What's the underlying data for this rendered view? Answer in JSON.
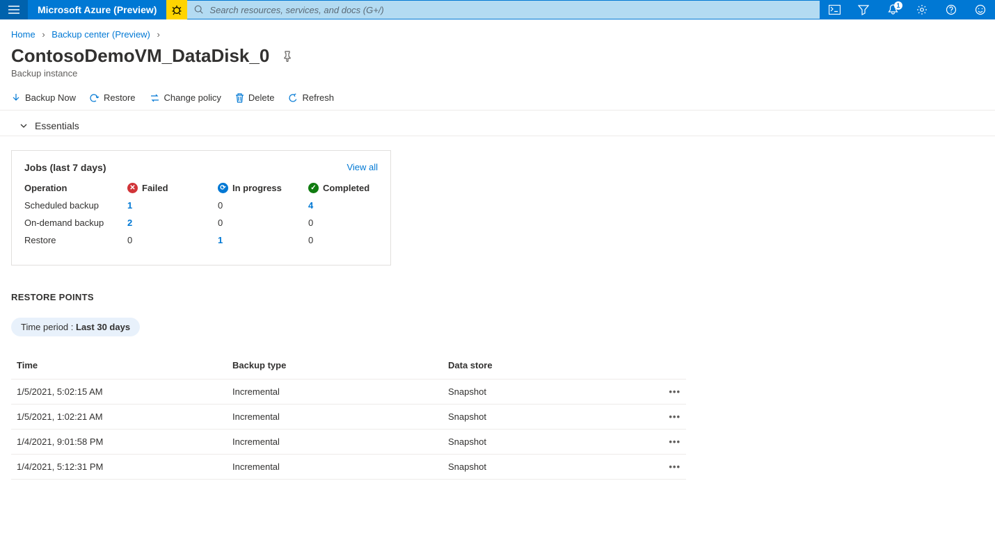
{
  "navbar": {
    "brand": "Microsoft Azure (Preview)",
    "search_placeholder": "Search resources, services, and docs (G+/)",
    "notification_badge": "1"
  },
  "breadcrumb": {
    "items": [
      "Home",
      "Backup center (Preview)"
    ]
  },
  "page": {
    "title": "ContosoDemoVM_DataDisk_0",
    "subtitle": "Backup instance"
  },
  "toolbar": {
    "backup_now": "Backup Now",
    "restore": "Restore",
    "change_policy": "Change policy",
    "delete": "Delete",
    "refresh": "Refresh"
  },
  "essentials": {
    "label": "Essentials"
  },
  "jobs": {
    "title": "Jobs (last 7 days)",
    "view_all": "View all",
    "headers": {
      "operation": "Operation",
      "failed": "Failed",
      "in_progress": "In progress",
      "completed": "Completed"
    },
    "rows": [
      {
        "op": "Scheduled backup",
        "failed": "1",
        "failed_link": true,
        "in_progress": "0",
        "in_progress_link": false,
        "completed": "4",
        "completed_link": true
      },
      {
        "op": "On-demand backup",
        "failed": "2",
        "failed_link": true,
        "in_progress": "0",
        "in_progress_link": false,
        "completed": "0",
        "completed_link": false
      },
      {
        "op": "Restore",
        "failed": "0",
        "failed_link": false,
        "in_progress": "1",
        "in_progress_link": true,
        "completed": "0",
        "completed_link": false
      }
    ]
  },
  "restore_points": {
    "section_title": "RESTORE POINTS",
    "filter_label": "Time period : ",
    "filter_value": "Last 30 days",
    "columns": {
      "time": "Time",
      "type": "Backup type",
      "store": "Data store"
    },
    "rows": [
      {
        "time": "1/5/2021, 5:02:15 AM",
        "type": "Incremental",
        "store": "Snapshot"
      },
      {
        "time": "1/5/2021, 1:02:21 AM",
        "type": "Incremental",
        "store": "Snapshot"
      },
      {
        "time": "1/4/2021, 9:01:58 PM",
        "type": "Incremental",
        "store": "Snapshot"
      },
      {
        "time": "1/4/2021, 5:12:31 PM",
        "type": "Incremental",
        "store": "Snapshot"
      }
    ]
  }
}
